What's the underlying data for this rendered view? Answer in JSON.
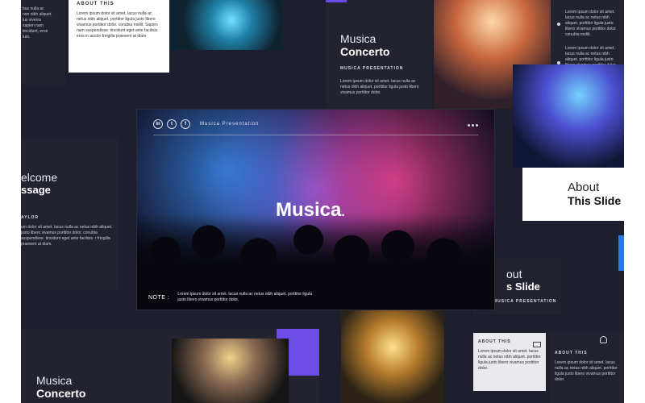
{
  "slides": {
    "top_left": {
      "lines": [
        "bus nulla ac",
        "non nibh aliquet.",
        "lus viverra",
        "sapien nam",
        "tincidunt, eros",
        "lum."
      ]
    },
    "about_card_top": {
      "label": "ABOUT THIS",
      "body": "Lorem ipsum dolor sit amet. lacus nulla ac netus nibh aliquet. porttitor ligula justo libero vivamus porttitor dolor. conubia mollit. Sapien nam suspendisse. tincidunt eget ante facilisis. eros in auctor fringilla praesent at diam."
    },
    "welcome": {
      "title_light": "elcome",
      "title_bold": "ssage",
      "name": "AYLOR",
      "body": "um dolor sit amet. lacus nulla ac netus nibh aliquet. justo libero vivamus porttitor dolor. conubia suspendisse. tincidunt eget ante facilisis. r fringilla praesent at diam."
    },
    "concerto_top": {
      "title_light": "Musica",
      "title_bold": "Concerto",
      "subtitle": "MUSICA PRESENTATION",
      "body": "Lorem ipsum dolor sit amet. lacus nulla ac netus nibh aliquet. porttitor ligula justo libero vivamus porttitor dolor."
    },
    "right_bullets": {
      "b1": "Lorem ipsum dolor sit amet. lacus nulla ac netus nibh aliquet. porttitor ligula justo libero vivamus porttitor dolor. conubia mollit.",
      "b2": "Lorem ipsum dolor sit amet. lacus nulla ac netus nibh aliquet. porttitor ligula justo libero vivamus porttitor dolor."
    },
    "about_right": {
      "title_light": "About",
      "title_bold": "This Slide"
    },
    "about_mid": {
      "title_light": "out",
      "title_bold": "s Slide",
      "subtitle": "MUSICA PRESENTATION"
    },
    "about_bottom_left": {
      "label": "ABOUT THIS",
      "body": "Lorem ipsum dolor sit amet. lacus nulla ac netus nibh aliquet. porttitor ligula justo libero vivamus porttitor dolor."
    },
    "about_bottom_right": {
      "label": "ABOUT THIS",
      "body": "Lorem ipsum dolor sit amet. lacus nulla ac netus nibh aliquet. porttitor ligula justo libero vivamus porttitor dolor."
    },
    "concerto_bottom": {
      "title_light": "Musica",
      "title_bold": "Concerto"
    }
  },
  "hero": {
    "social": [
      "in",
      "t",
      "f"
    ],
    "top_label": "Musica Presentation",
    "title": "Musica",
    "title_dot": ".",
    "note_label": "NOTE :",
    "note_text": "Lorem ipsum dolor sit amet. lacus nulla ac netus nibh aliquet. porttitor ligula justo libero vivamus porttitor dolor."
  },
  "colors": {
    "background": "#1d1f2e",
    "accent_purple": "#6b4de6",
    "accent_blue": "#2c7be5"
  },
  "icons": [
    "linkedin-icon",
    "twitter-icon",
    "facebook-icon",
    "menu-dots-icon",
    "envelope-icon",
    "user-icon"
  ]
}
